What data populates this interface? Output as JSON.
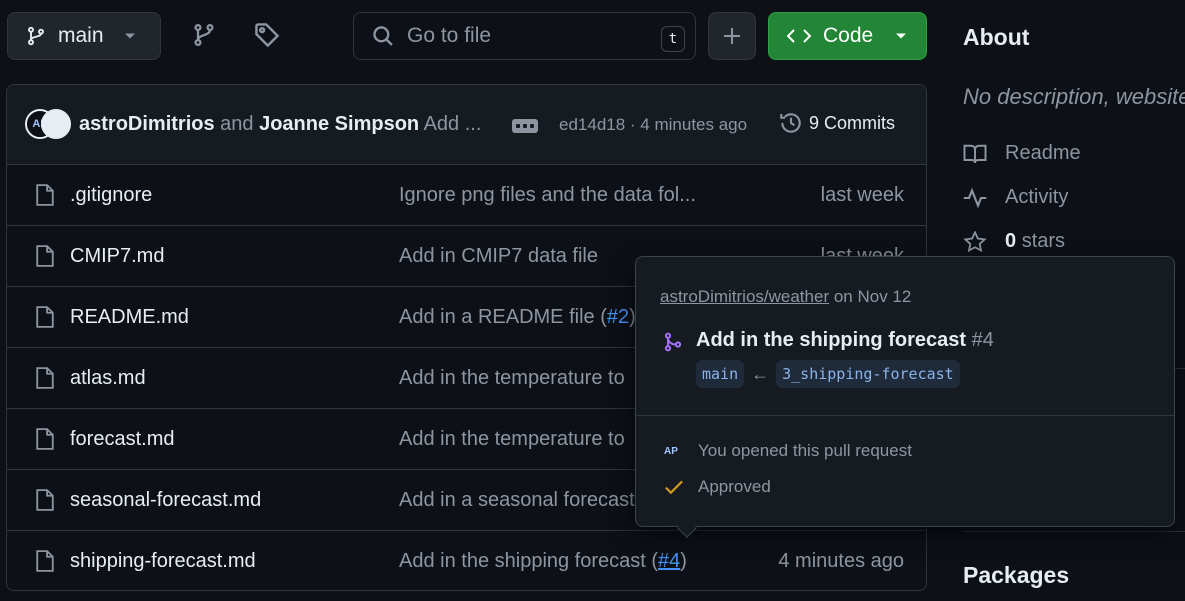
{
  "toolbar": {
    "branch_label": "main",
    "search_placeholder": "Go to file",
    "search_shortcut": "t",
    "code_label": "Code"
  },
  "commit": {
    "avatar_initials": "AP",
    "author_1": "astroDimitrios",
    "joiner": "and",
    "author_2": "Joanne Simpson",
    "message": "Add ...",
    "sha_time": "ed14d18 · 4 minutes ago",
    "commits_label": "9 Commits"
  },
  "files": [
    {
      "name": ".gitignore",
      "message": "Ignore png files and the data fol...",
      "link": "",
      "suffix": "",
      "date": "last week"
    },
    {
      "name": "CMIP7.md",
      "message": "Add in CMIP7 data file",
      "link": "",
      "suffix": "",
      "date": "last week"
    },
    {
      "name": "README.md",
      "message": "Add in a README file (",
      "link": "#2",
      "suffix": ")",
      "date": ""
    },
    {
      "name": "atlas.md",
      "message": "Add in the temperature to",
      "link": "",
      "suffix": "",
      "date": ""
    },
    {
      "name": "forecast.md",
      "message": "Add in the temperature to",
      "link": "",
      "suffix": "",
      "date": ""
    },
    {
      "name": "seasonal-forecast.md",
      "message": "Add in a seasonal forecast",
      "link": "",
      "suffix": "",
      "date": ""
    },
    {
      "name": "shipping-forecast.md",
      "message": "Add in the shipping forecast (",
      "link": "#4",
      "suffix": ")",
      "date": "4 minutes ago"
    }
  ],
  "sidebar": {
    "about_title": "About",
    "description": "No description, website",
    "readme_label": "Readme",
    "activity_label": "Activity",
    "stars_count": "0",
    "stars_label": "stars",
    "packages_title": "Packages"
  },
  "hovercard": {
    "repo_link": "astroDimitrios/weather",
    "repo_date": "on Nov 12",
    "pr_title": "Add in the shipping forecast",
    "pr_number": "#4",
    "base_branch": "main",
    "arrow": "←",
    "head_branch": "3_shipping-forecast",
    "avatar_initials": "AP",
    "opened_text": "You opened this pull request",
    "approved_text": "Approved"
  },
  "colors": {
    "background": "#0d1117",
    "code_button": "#238636",
    "link": "#4493f8",
    "pr_open": "#a371f7",
    "approved": "#d29922"
  }
}
